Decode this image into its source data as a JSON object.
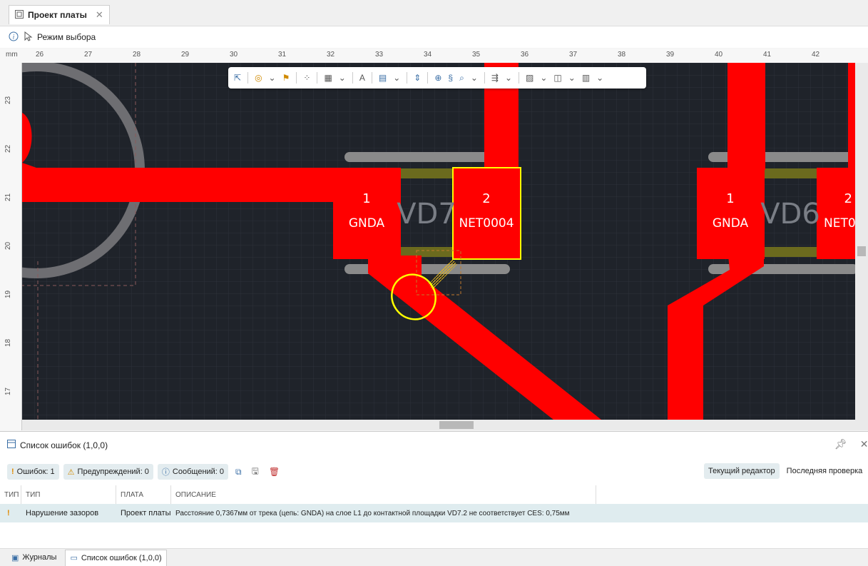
{
  "tab": {
    "title": "Проект платы",
    "close": "✕"
  },
  "modebar": {
    "mode_label": "Режим выбора"
  },
  "ruler": {
    "unit": "mm",
    "x_ticks": [
      "26",
      "27",
      "28",
      "29",
      "30",
      "31",
      "32",
      "33",
      "34",
      "35",
      "36",
      "37",
      "38",
      "39",
      "40",
      "41",
      "42"
    ],
    "y_ticks": [
      "23",
      "22",
      "21",
      "20",
      "19",
      "18",
      "17"
    ]
  },
  "canvas": {
    "components": [
      {
        "ref": "VD7",
        "pads": [
          {
            "num": "1",
            "net": "GNDA"
          },
          {
            "num": "2",
            "net": "NET0004"
          }
        ]
      },
      {
        "ref": "VD6",
        "pads": [
          {
            "num": "1",
            "net": "GNDA"
          },
          {
            "num": "2",
            "net": "NET0"
          }
        ]
      }
    ],
    "colors": {
      "copper": "#ff0000",
      "background": "#1f232a",
      "highlight": "#ffff00",
      "silk": "#8a8a8a"
    }
  },
  "errors_panel": {
    "title": "Список ошибок (1,0,0)",
    "filters": {
      "errors": "Ошибок: 1",
      "warnings": "Предупреждений: 0",
      "messages": "Сообщений: 0"
    },
    "views": {
      "current": "Текущий редактор",
      "last": "Последняя проверка"
    },
    "columns": [
      "ТИП",
      "ТИП",
      "ПЛАТА",
      "ОПИСАНИЕ"
    ],
    "rows": [
      {
        "severity": "!",
        "type": "Нарушение зазоров",
        "board": "Проект платы",
        "description": "Расстояние 0,7367мм от трека (цепь: GNDA) на слое L1 до контактной площадки VD7.2 не соответствует CES: 0,75мм"
      }
    ]
  },
  "bottom_tabs": {
    "journals": "Журналы",
    "errors": "Список ошибок (1,0,0)"
  }
}
